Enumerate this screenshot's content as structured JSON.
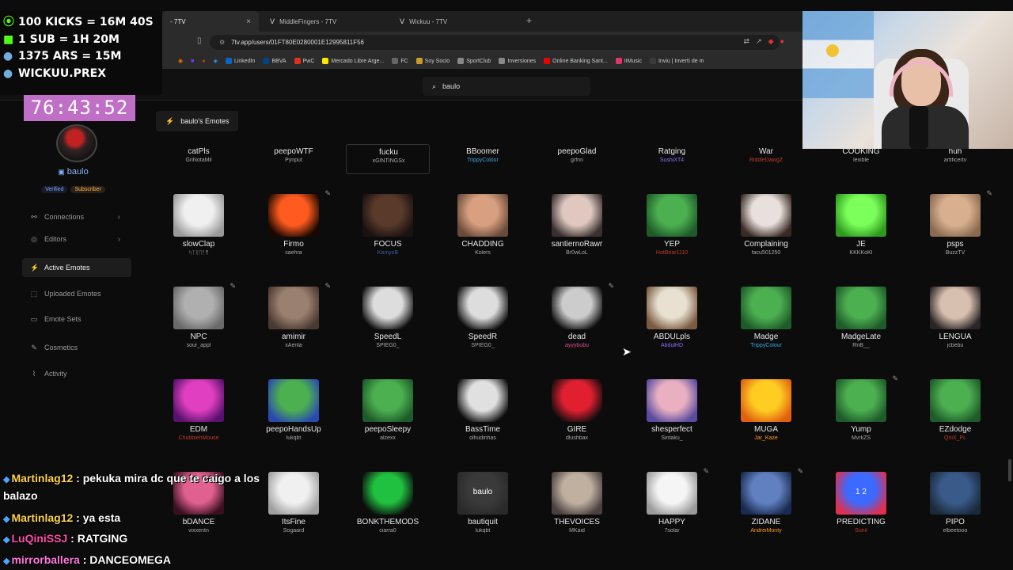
{
  "browser": {
    "tabs": [
      {
        "title": "- 7TV",
        "close": "×"
      },
      {
        "title": "MiddleFingers - 7TV"
      },
      {
        "title": "Wickuu - 7TV"
      }
    ],
    "new_tab": "+",
    "url": "7tv.app/users/01FT80E0280001E12995811F56",
    "bookmarks": [
      "LinkedIn",
      "BBVA",
      "PwC",
      "Mercado Libre Arge...",
      "FC",
      "Soy Socio",
      "SportClub",
      "Inversiones",
      "Online Banking Sant...",
      "IIMusic",
      "Inviu | Invertí de m"
    ]
  },
  "header": {
    "search_value": "baulo"
  },
  "user": {
    "name": "baulo",
    "badge_verified": "Verified",
    "badge_subscriber": "Subscriber"
  },
  "nav": [
    {
      "label": "Connections",
      "icon": "link-icon",
      "chevron": "›"
    },
    {
      "label": "Editors",
      "icon": "user-icon",
      "chevron": "›"
    },
    {
      "label": "Active Emotes",
      "icon": "bolt-icon"
    },
    {
      "label": "Uploaded Emotes",
      "icon": "upload-icon"
    },
    {
      "label": "Emote Sets",
      "icon": "folder-icon"
    },
    {
      "label": "Cosmetics",
      "icon": "brush-icon"
    },
    {
      "label": "Activity",
      "icon": "activity-icon"
    }
  ],
  "emote_section_title": "baulo's Emotes",
  "top_row": [
    {
      "name": "catPls",
      "owner": "GriNotaMil",
      "owner_color": "#aaaaaa"
    },
    {
      "name": "peepoWTF",
      "owner": "Pynput",
      "owner_color": "#aaaaaa"
    },
    {
      "name": "fucku",
      "owner": "xGINTINGSx",
      "owner_color": "#aaaaaa"
    },
    {
      "name": "BBoomer",
      "owner": "TrippyColour",
      "owner_color": "#3aa6e8"
    },
    {
      "name": "peepoGlad",
      "owner": "grfnn",
      "owner_color": "#aaaaaa"
    },
    {
      "name": "Ratging",
      "owner": "SushiXT4",
      "owner_color": "#8f6cff"
    },
    {
      "name": "War",
      "owner": "RiddleDawgZ",
      "owner_color": "#c0392b"
    },
    {
      "name": "COOKING",
      "owner": "lexible",
      "owner_color": "#aaaaaa"
    },
    {
      "name": "huh",
      "owner": "artificertv",
      "owner_color": "#aaaaaa"
    }
  ],
  "emotes": [
    {
      "name": "slowClap",
      "owner": "ᛋᛏᚱᛖᚨᛗ",
      "owner_color": "#aaaaaa",
      "c1": "#f0f0f0",
      "c2": "#9a9a9a"
    },
    {
      "name": "Firmo",
      "owner": "saehra",
      "owner_color": "#aaaaaa",
      "c1": "#ff5a1f",
      "c2": "#1a0800",
      "edit": true
    },
    {
      "name": "FOCUS",
      "owner": "KamyuB",
      "owner_color": "#3a5fa8",
      "c1": "#5a3a2a",
      "c2": "#1a1210"
    },
    {
      "name": "CHADDING",
      "owner": "Kolers",
      "owner_color": "#aaaaaa",
      "c1": "#d8a080",
      "c2": "#6a4a3a"
    },
    {
      "name": "santiernoRawr",
      "owner": "Br0wLoL",
      "owner_color": "#aaaaaa",
      "c1": "#e0c8c0",
      "c2": "#3a3030"
    },
    {
      "name": "YEP",
      "owner": "HotBear1110",
      "owner_color": "#c0392b",
      "c1": "#4caf50",
      "c2": "#1e5a2a"
    },
    {
      "name": "Complaining",
      "owner": "facu501250",
      "owner_color": "#aaaaaa",
      "c1": "#e8e0dc",
      "c2": "#3a2a25"
    },
    {
      "name": "JE",
      "owner": "KKKKoKI",
      "owner_color": "#aaaaaa",
      "c1": "#7cff5a",
      "c2": "#2e9a1e"
    },
    {
      "name": "psps",
      "owner": "BuzzTV",
      "owner_color": "#aaaaaa",
      "c1": "#d8b090",
      "c2": "#8a6a50",
      "edit": true
    },
    {
      "name": "NPC",
      "owner": "sour_appl",
      "owner_color": "#aaaaaa",
      "c1": "#b0b0b0",
      "c2": "#6a6a6a",
      "edit": true
    },
    {
      "name": "amimir",
      "owner": "xAerila",
      "owner_color": "#aaaaaa",
      "c1": "#9a8070",
      "c2": "#4a3a30",
      "edit": true
    },
    {
      "name": "SpeedL",
      "owner": "SPIEG0_",
      "owner_color": "#aaaaaa",
      "c1": "#dddddd",
      "c2": "#0c0c0c"
    },
    {
      "name": "SpeedR",
      "owner": "SPIEG0_",
      "owner_color": "#aaaaaa",
      "c1": "#dddddd",
      "c2": "#0c0c0c"
    },
    {
      "name": "dead",
      "owner": "ayyybubu",
      "owner_color": "#e05090",
      "c1": "#cccccc",
      "c2": "#0c0c0c",
      "edit": true
    },
    {
      "name": "ABDULpls",
      "owner": "AbdulHD",
      "owner_color": "#8f6cff",
      "c1": "#e8e0d0",
      "c2": "#7a5a40"
    },
    {
      "name": "Madge",
      "owner": "TrippyColour",
      "owner_color": "#3aa6e8",
      "c1": "#4caf50",
      "c2": "#1e5a2a"
    },
    {
      "name": "MadgeLate",
      "owner": "RnB__",
      "owner_color": "#aaaaaa",
      "c1": "#4caf50",
      "c2": "#1e5a2a"
    },
    {
      "name": "LENGUA",
      "owner": "jcbebu",
      "owner_color": "#aaaaaa",
      "c1": "#d8c0b0",
      "c2": "#2a2525"
    },
    {
      "name": "EDM",
      "owner": "ChubbiehMouse",
      "owner_color": "#c0392b",
      "c1": "#e040c0",
      "c2": "#5a1070"
    },
    {
      "name": "peepoHandsUp",
      "owner": "lukqbt",
      "owner_color": "#aaaaaa",
      "c1": "#4caf50",
      "c2": "#2a4ab0"
    },
    {
      "name": "peepoSleepy",
      "owner": "alzexx",
      "owner_color": "#aaaaaa",
      "c1": "#4caf50",
      "c2": "#1e5a2a"
    },
    {
      "name": "BassTime",
      "owner": "olhudinhas",
      "owner_color": "#aaaaaa",
      "c1": "#e0e0e0",
      "c2": "#0c0c0c"
    },
    {
      "name": "GIRE",
      "owner": "dlushbax",
      "owner_color": "#aaaaaa",
      "c1": "#e02030",
      "c2": "#0c0c0c"
    },
    {
      "name": "shesperfect",
      "owner": "Sintaku_",
      "owner_color": "#aaaaaa",
      "c1": "#e8b0c0",
      "c2": "#5a4aa0"
    },
    {
      "name": "MUGA",
      "owner": "Jar_Kaze",
      "owner_color": "#ff9a1f",
      "c1": "#ffcc22",
      "c2": "#e06010"
    },
    {
      "name": "Yump",
      "owner": "MvrkZS",
      "owner_color": "#aaaaaa",
      "c1": "#4caf50",
      "c2": "#1e5a2a",
      "edit": true
    },
    {
      "name": "EZdodge",
      "owner": "QniX_PL",
      "owner_color": "#c0392b",
      "c1": "#4caf50",
      "c2": "#1e5a2a"
    },
    {
      "name": "bDANCE",
      "owner": "vixxentn",
      "owner_color": "#aaaaaa",
      "c1": "#e06090",
      "c2": "#3a1020"
    },
    {
      "name": "ItsFine",
      "owner": "Sogaard",
      "owner_color": "#aaaaaa",
      "c1": "#f0f0f0",
      "c2": "#a0a0a0"
    },
    {
      "name": "BONKTHEMODS",
      "owner": "ciarra0",
      "owner_color": "#aaaaaa",
      "c1": "#20c040",
      "c2": "#0c0c0c"
    },
    {
      "name": "bautiquit",
      "owner": "lukqbt",
      "owner_color": "#aaaaaa",
      "c1": "#3a3a3a",
      "c2": "#2a2a2a",
      "label": "baulo"
    },
    {
      "name": "THEVOICES",
      "owner": "MKaid",
      "owner_color": "#aaaaaa",
      "c1": "#c0b0a0",
      "c2": "#4a4040"
    },
    {
      "name": "HAPPY",
      "owner": "7solar",
      "owner_color": "#aaaaaa",
      "c1": "#f5f5f5",
      "c2": "#9a9a9a",
      "edit": true
    },
    {
      "name": "ZIDANE",
      "owner": "AndreiMonty",
      "owner_color": "#ff9a1f",
      "c1": "#6080c0",
      "c2": "#1a2a50",
      "edit": true
    },
    {
      "name": "PREDICTING",
      "owner": "Sunil",
      "owner_color": "#c0392b",
      "c1": "#3a6aff",
      "c2": "#e03050",
      "label": "1 2"
    },
    {
      "name": "PIPO",
      "owner": "elbeetooo",
      "owner_color": "#aaaaaa",
      "c1": "#3a5a8a",
      "c2": "#1a2a3a"
    }
  ],
  "overlay": {
    "promo": [
      {
        "text": "100 KICKS = 16M 40S",
        "icon": "kick-icon",
        "icon_glyph": "⦿",
        "color": "#53fc18"
      },
      {
        "text": "1 SUB = 1H 20M",
        "icon": "gift-icon",
        "icon_glyph": "■",
        "color": "#53fc18"
      },
      {
        "text": "1375 ARS = 15M",
        "icon": "argentina-flag-icon",
        "icon_glyph": "●",
        "color": "#74acdf"
      },
      {
        "text": "WICKUU.PREX",
        "icon": "prex-icon",
        "icon_glyph": "●",
        "color": "#74acdf"
      }
    ],
    "timer": "76:43:52"
  },
  "chat": [
    {
      "user": "Martinlag12",
      "user_color": "#ffd54a",
      "message": " : pekuka mira dc que te caigo a los",
      "icon": true
    },
    {
      "user": "",
      "user_color": "#ffffff",
      "message": "balazo",
      "icon": false
    },
    {
      "user": "Martinlag12",
      "user_color": "#ffd54a",
      "message": " : ya esta",
      "icon": true
    },
    {
      "user": "LuQiniSSJ",
      "user_color": "#ff4fa8",
      "message": " : RATGING",
      "icon": true
    },
    {
      "user": "mirrorballera",
      "user_color": "#ff7adf",
      "message": " : DANCEOMEGA",
      "icon": true
    }
  ]
}
